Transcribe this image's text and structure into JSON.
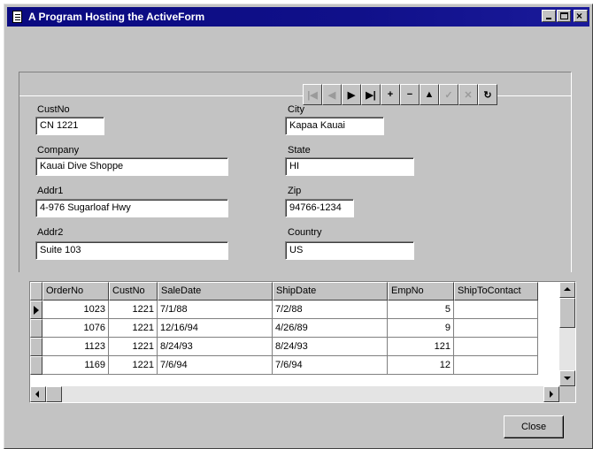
{
  "window": {
    "title": "A Program Hosting the ActiveForm"
  },
  "navigator": {
    "buttons": [
      {
        "name": "first",
        "glyph": "|◀",
        "enabled": false
      },
      {
        "name": "prior",
        "glyph": "◀",
        "enabled": false
      },
      {
        "name": "next",
        "glyph": "▶",
        "enabled": true
      },
      {
        "name": "last",
        "glyph": "▶|",
        "enabled": true
      },
      {
        "name": "insert",
        "glyph": "+",
        "enabled": true
      },
      {
        "name": "delete",
        "glyph": "−",
        "enabled": true
      },
      {
        "name": "edit",
        "glyph": "▲",
        "enabled": true
      },
      {
        "name": "post",
        "glyph": "✓",
        "enabled": false
      },
      {
        "name": "cancel",
        "glyph": "✕",
        "enabled": false
      },
      {
        "name": "refresh",
        "glyph": "↻",
        "enabled": true
      }
    ]
  },
  "form": {
    "custno_label": "CustNo",
    "custno_value": "CN 1221",
    "company_label": "Company",
    "company_value": "Kauai Dive Shoppe",
    "addr1_label": "Addr1",
    "addr1_value": "4-976 Sugarloaf Hwy",
    "addr2_label": "Addr2",
    "addr2_value": "Suite 103",
    "city_label": "City",
    "city_value": "Kapaa Kauai",
    "state_label": "State",
    "state_value": "HI",
    "zip_label": "Zip",
    "zip_value": "94766-1234",
    "country_label": "Country",
    "country_value": "US"
  },
  "grid": {
    "columns": [
      "OrderNo",
      "CustNo",
      "SaleDate",
      "ShipDate",
      "EmpNo",
      "ShipToContact"
    ],
    "rows": [
      [
        "1023",
        "1221",
        "7/1/88",
        "7/2/88",
        "5",
        ""
      ],
      [
        "1076",
        "1221",
        "12/16/94",
        "4/26/89",
        "9",
        ""
      ],
      [
        "1123",
        "1221",
        "8/24/93",
        "8/24/93",
        "121",
        ""
      ],
      [
        "1169",
        "1221",
        "7/6/94",
        "7/6/94",
        "12",
        ""
      ]
    ],
    "current_row": 0
  },
  "footer": {
    "close_label": "Close"
  }
}
